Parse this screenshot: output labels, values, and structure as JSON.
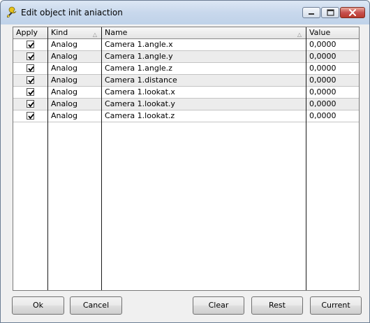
{
  "window": {
    "title": "Edit object init aniaction"
  },
  "grid": {
    "columns": [
      "Apply",
      "Kind",
      "Name",
      "Value"
    ],
    "rows": [
      {
        "apply": true,
        "kind": "Analog",
        "name": "Camera 1.angle.x",
        "value": "0,0000"
      },
      {
        "apply": true,
        "kind": "Analog",
        "name": "Camera 1.angle.y",
        "value": "0,0000"
      },
      {
        "apply": true,
        "kind": "Analog",
        "name": "Camera 1.angle.z",
        "value": "0,0000"
      },
      {
        "apply": true,
        "kind": "Analog",
        "name": "Camera 1.distance",
        "value": "0,0000"
      },
      {
        "apply": true,
        "kind": "Analog",
        "name": "Camera 1.lookat.x",
        "value": "0,0000"
      },
      {
        "apply": true,
        "kind": "Analog",
        "name": "Camera 1.lookat.y",
        "value": "0,0000"
      },
      {
        "apply": true,
        "kind": "Analog",
        "name": "Camera 1.lookat.z",
        "value": "0,0000"
      }
    ]
  },
  "buttons": {
    "ok": "Ok",
    "cancel": "Cancel",
    "clear": "Clear",
    "rest": "Rest",
    "current": "Current"
  },
  "icons": {
    "app": "wrench-icon",
    "sort": "sort-ascending-icon",
    "minimize": "minimize-icon",
    "maximize": "maximize-icon",
    "close": "close-icon"
  }
}
